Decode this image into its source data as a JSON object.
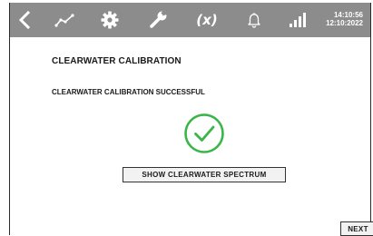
{
  "topbar": {
    "icons": {
      "back": "back-chevron-icon",
      "trend": "trend-line-icon",
      "settings": "gear-icon",
      "service": "wrench-icon",
      "variables": "variables-icon",
      "alarms": "bell-icon",
      "signal": "signal-bars-icon"
    },
    "variables_label": "(x)",
    "time": "14:10:56",
    "date": "12:10:2022"
  },
  "page": {
    "title": "CLEARWATER CALIBRATION",
    "status_message": "CLEARWATER CALIBRATION SUCCESSFUL",
    "status_icon": "check-circle-icon"
  },
  "buttons": {
    "show_spectrum": "SHOW CLEARWATER SPECTRUM",
    "next": "NEXT"
  },
  "colors": {
    "topbar_background": "#8c8c8c",
    "success_green": "#3ab54a",
    "text": "#1a1a1a"
  }
}
